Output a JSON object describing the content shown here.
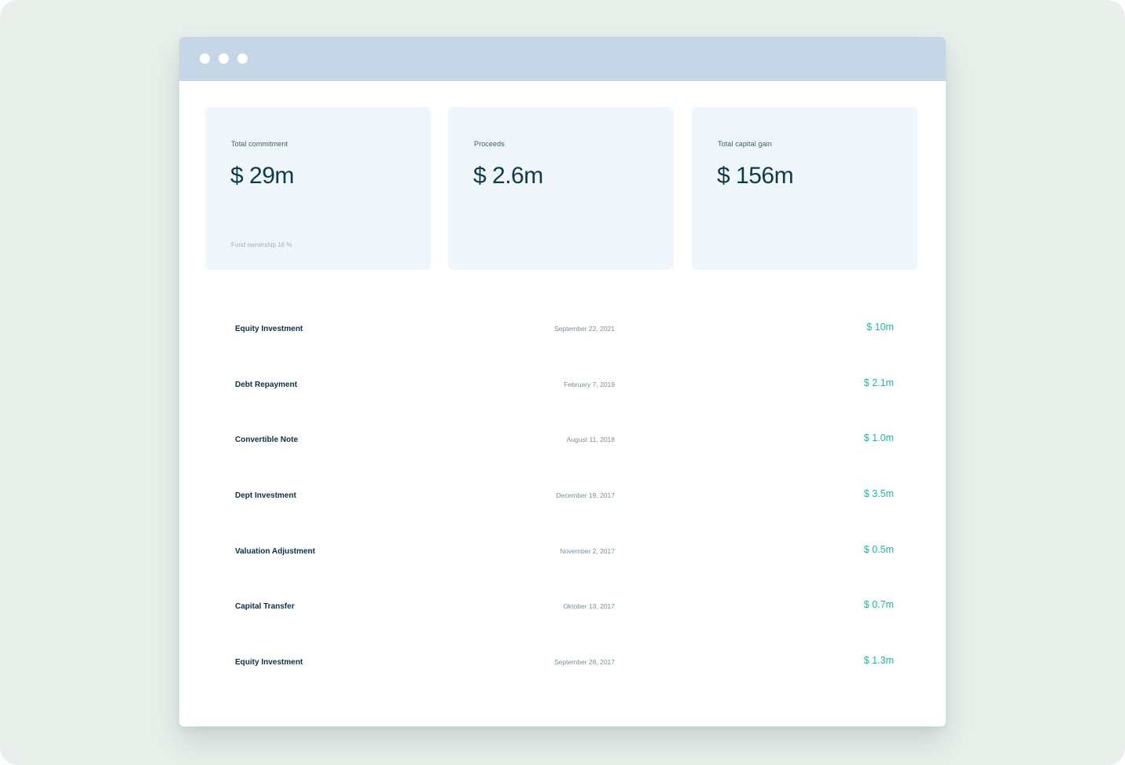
{
  "colors": {
    "backdrop": "#e9f0ec",
    "titlebar": "#c5d7e6",
    "card_bg": "#eff7fd",
    "value_text": "#0e3a4a",
    "amount_accent": "#1bb7a3"
  },
  "window": {
    "controls": [
      "window-dot-icon",
      "window-dot-icon",
      "window-dot-icon"
    ]
  },
  "cards": [
    {
      "label": "Total commitment",
      "value": "$ 29m",
      "footnote": "Fund ownership 16 %"
    },
    {
      "label": "Proceeds",
      "value": "$ 2.6m",
      "footnote": ""
    },
    {
      "label": "Total capital gain",
      "value": "$ 156m",
      "footnote": ""
    }
  ],
  "transactions": [
    {
      "name": "Equity Investment",
      "date": "September 22, 2021",
      "amount": "$ 10m"
    },
    {
      "name": "Debt Repayment",
      "date": "February 7, 2019",
      "amount": "$ 2.1m"
    },
    {
      "name": "Convertible Note",
      "date": "August 11, 2018",
      "amount": "$ 1.0m"
    },
    {
      "name": "Dept Investment",
      "date": "December 19, 2017",
      "amount": "$ 3.5m"
    },
    {
      "name": "Valuation Adjustment",
      "date": "November 2, 2017",
      "amount": "$ 0.5m"
    },
    {
      "name": "Capital Transfer",
      "date": "Oktober 13, 2017",
      "amount": "$ 0.7m"
    },
    {
      "name": "Equity Investment",
      "date": "September 28, 2017",
      "amount": "$ 1.3m"
    }
  ]
}
